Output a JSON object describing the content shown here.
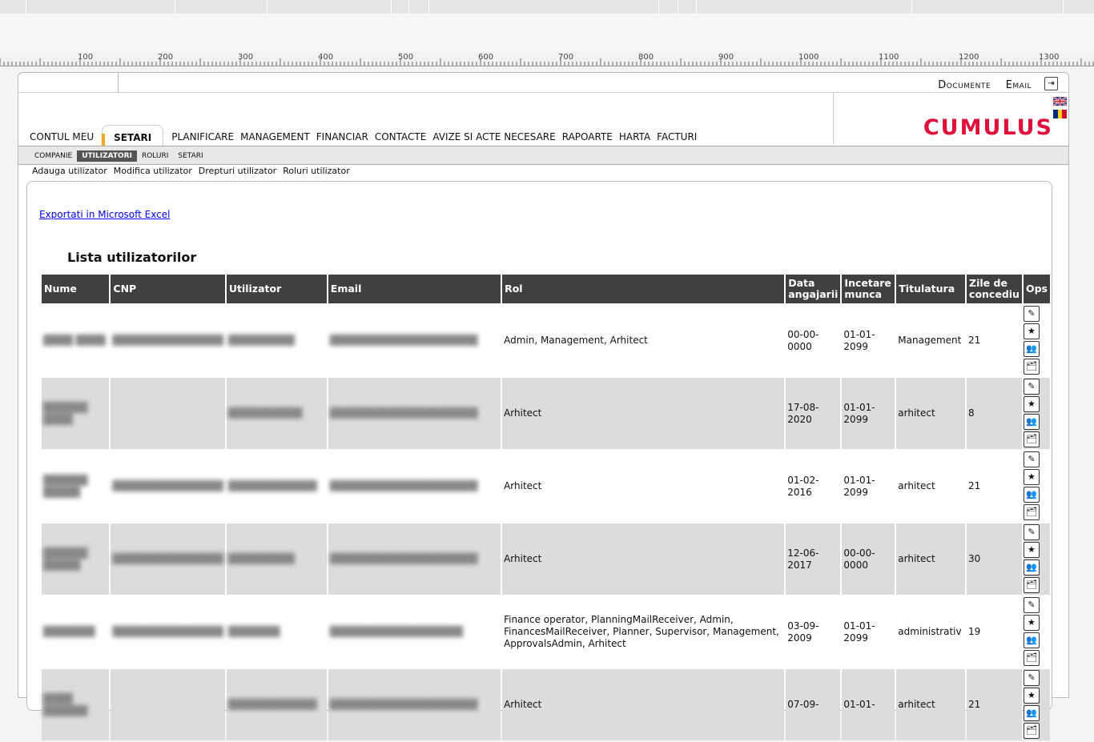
{
  "app": {
    "logo_text": "CUMULUS",
    "accent_color": "#e0103c",
    "tab_accent_color": "#f5a623"
  },
  "header": {
    "links": [
      "Documente",
      "Email"
    ],
    "logout_icon": "logout-icon"
  },
  "ruler": {
    "labels": [
      "100",
      "200",
      "300",
      "400",
      "500",
      "600",
      "700",
      "800",
      "900",
      "1000",
      "1100",
      "1200",
      "1300"
    ]
  },
  "main_nav": {
    "items": [
      "CONTUL MEU",
      "SETARI",
      "PLANIFICARE",
      "MANAGEMENT",
      "FINANCIAR",
      "CONTACTE",
      "AVIZE SI ACTE NECESARE",
      "RAPOARTE",
      "HARTA",
      "FACTURI"
    ],
    "active": "SETARI"
  },
  "sub_nav": {
    "items": [
      "COMPANIE",
      "UTILIZATORI",
      "ROLURI",
      "SETARI"
    ],
    "active": "UTILIZATORI"
  },
  "actions": [
    "Adauga utilizator",
    "Modifica utilizator",
    "Drepturi utilizator",
    "Roluri utilizator"
  ],
  "export_link": "Exportati in Microsoft Excel",
  "list_title": "Lista utilizatorilor",
  "table": {
    "headers": [
      "Nume",
      "CNP",
      "Utilizator",
      "Email",
      "Rol",
      "Data angajarii",
      "Incetare munca",
      "Titulatura",
      "Zile de concediu",
      "Ops"
    ],
    "ops_icons": [
      "edit-icon",
      "star-icon",
      "users-icon",
      "folder-icon"
    ],
    "rows": [
      {
        "nume": "████ ████",
        "cnp": "███████████████",
        "utilizator": "█████████",
        "email": "████████████████████",
        "rol": "Admin, Management, Arhitect",
        "data": "00-00-0000",
        "incetare": "01-01-2099",
        "titulatura": "Management",
        "zile": "21"
      },
      {
        "nume": "██████ ████",
        "cnp": "",
        "utilizator": "██████████",
        "email": "████████████████████",
        "rol": "Arhitect",
        "data": "17-08-2020",
        "incetare": "01-01-2099",
        "titulatura": "arhitect",
        "zile": "8"
      },
      {
        "nume": "██████ █████",
        "cnp": "███████████████",
        "utilizator": "████████████",
        "email": "████████████████████",
        "rol": "Arhitect",
        "data": "01-02-2016",
        "incetare": "01-01-2099",
        "titulatura": "arhitect",
        "zile": "21"
      },
      {
        "nume": "██████ █████",
        "cnp": "███████████████",
        "utilizator": "█████████",
        "email": "████████████████████",
        "rol": "Arhitect",
        "data": "12-06-2017",
        "incetare": "00-00-0000",
        "titulatura": "arhitect",
        "zile": "30"
      },
      {
        "nume": "███████",
        "cnp": "███████████████",
        "utilizator": "███████",
        "email": "██████████████████",
        "rol": "Finance operator, PlanningMailReceiver, Admin, FinancesMailReceiver, Planner, Supervisor, Management, ApprovalsAdmin, Arhitect",
        "data": "03-09-2009",
        "incetare": "01-01-2099",
        "titulatura": "administrativ",
        "zile": "19"
      },
      {
        "nume": "████ ██████",
        "cnp": "",
        "utilizator": "████████████",
        "email": "████████████████████",
        "rol": "Arhitect",
        "data": "07-09-",
        "incetare": "01-01-",
        "titulatura": "arhitect",
        "zile": "21"
      }
    ]
  }
}
